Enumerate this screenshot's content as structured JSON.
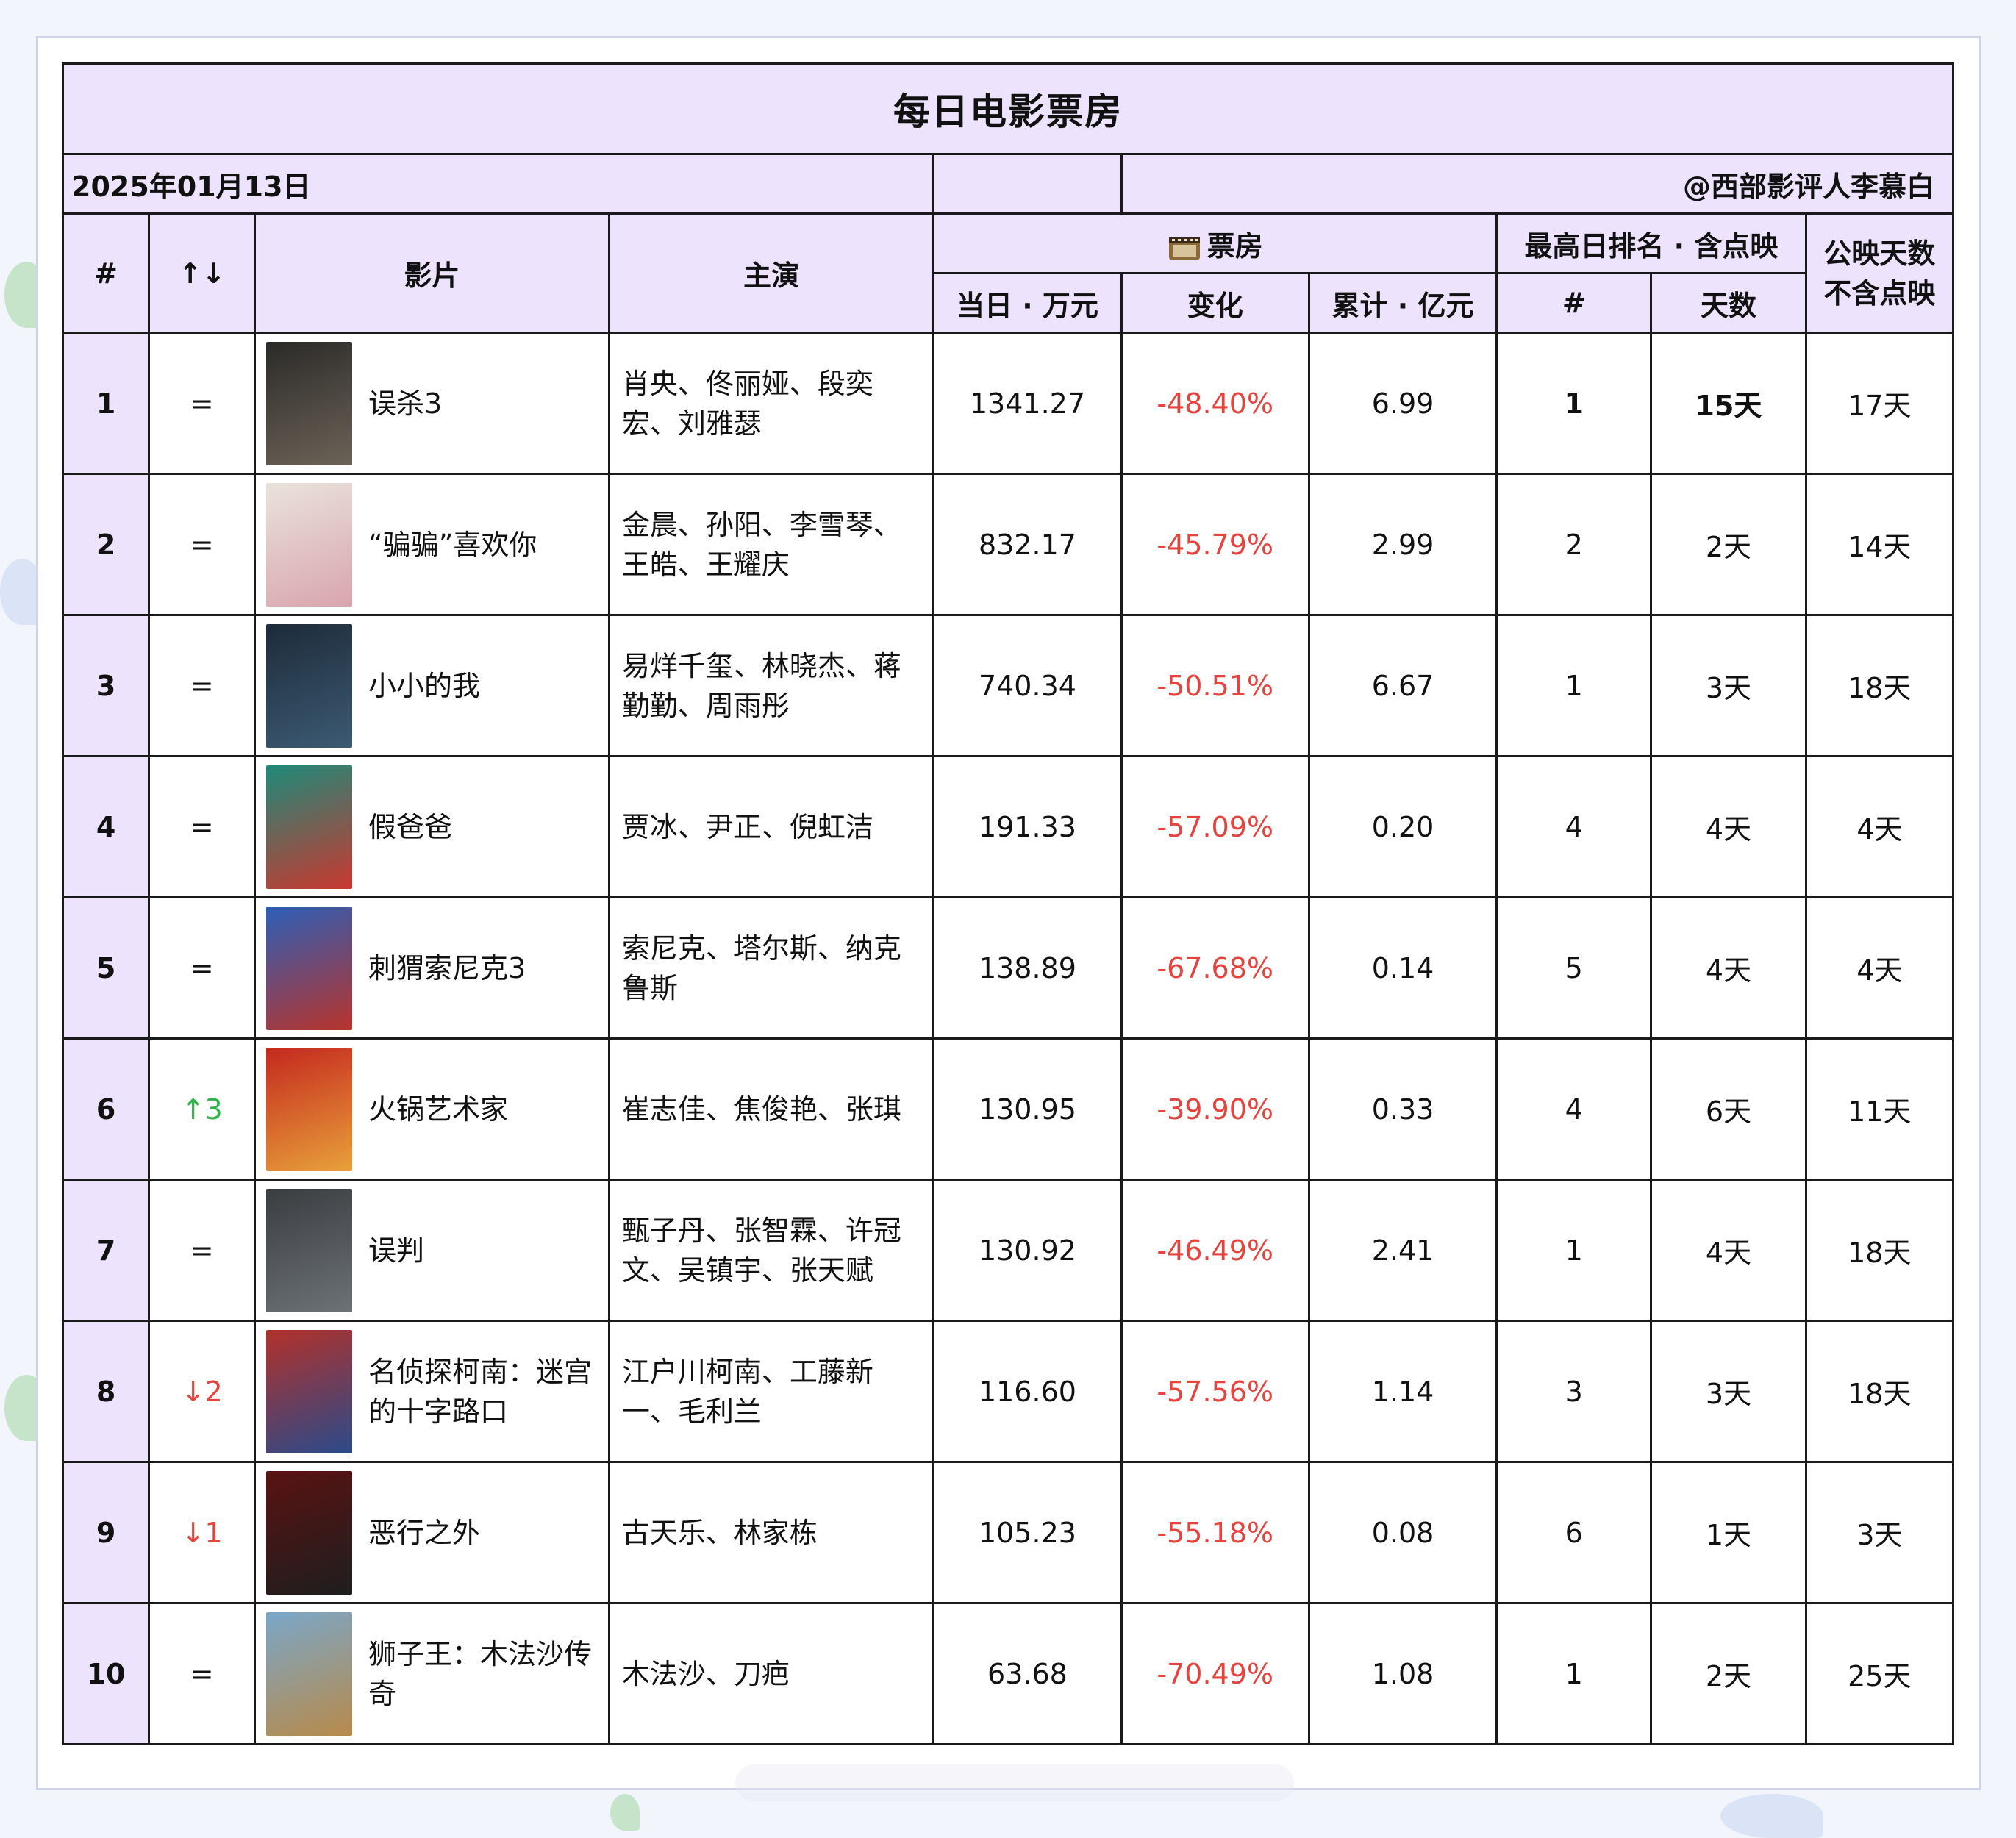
{
  "title": "每日电影票房",
  "date": "2025年01月13日",
  "author": "@西部影评人李慕白",
  "headers": {
    "rank": "#",
    "change": "↑↓",
    "film": "影片",
    "cast": "主演",
    "boxoffice_group": "票房",
    "today": "当日 · 万元",
    "delta": "变化",
    "total": "累计 · 亿元",
    "best_group": "最高日排名 · 含点映",
    "best_rank": "#",
    "best_days": "天数",
    "release_days": "公映天数\n不含点映"
  },
  "colors": {
    "header_bg": "#ede3fd",
    "negative": "#e5433d",
    "up": "#2cb34a",
    "down": "#e5433d"
  },
  "rows": [
    {
      "rank": "1",
      "change": "=",
      "change_type": "same",
      "film": "误杀3",
      "cast": "肖央、佟丽娅、段奕宏、刘雅瑟",
      "today": "1341.27",
      "delta": "-48.40%",
      "total": "6.99",
      "best_rank": "1",
      "best_days": "15天",
      "release_days": "17天",
      "poster_colors": [
        "#2b2a28",
        "#6b6357"
      ]
    },
    {
      "rank": "2",
      "change": "=",
      "change_type": "same",
      "film": "“骗骗”喜欢你",
      "cast": "金晨、孙阳、李雪琴、王皓、王耀庆",
      "today": "832.17",
      "delta": "-45.79%",
      "total": "2.99",
      "best_rank": "2",
      "best_days": "2天",
      "release_days": "14天",
      "poster_colors": [
        "#e9e3dc",
        "#d9a5ad"
      ]
    },
    {
      "rank": "3",
      "change": "=",
      "change_type": "same",
      "film": "小小的我",
      "cast": "易烊千玺、林晓杰、蒋勤勤、周雨彤",
      "today": "740.34",
      "delta": "-50.51%",
      "total": "6.67",
      "best_rank": "1",
      "best_days": "3天",
      "release_days": "18天",
      "poster_colors": [
        "#1d2b3a",
        "#3c5a73"
      ]
    },
    {
      "rank": "4",
      "change": "=",
      "change_type": "same",
      "film": "假爸爸",
      "cast": "贾冰、尹正、倪虹洁",
      "today": "191.33",
      "delta": "-57.09%",
      "total": "0.20",
      "best_rank": "4",
      "best_days": "4天",
      "release_days": "4天",
      "poster_colors": [
        "#1d8a7a",
        "#c9382f"
      ]
    },
    {
      "rank": "5",
      "change": "=",
      "change_type": "same",
      "film": "刺猬索尼克3",
      "cast": "索尼克、塔尔斯、纳克鲁斯",
      "today": "138.89",
      "delta": "-67.68%",
      "total": "0.14",
      "best_rank": "5",
      "best_days": "4天",
      "release_days": "4天",
      "poster_colors": [
        "#2c5fb8",
        "#b8342c"
      ]
    },
    {
      "rank": "6",
      "change": "↑3",
      "change_type": "up",
      "film": "火锅艺术家",
      "cast": "崔志佳、焦俊艳、张琪",
      "today": "130.95",
      "delta": "-39.90%",
      "total": "0.33",
      "best_rank": "4",
      "best_days": "6天",
      "release_days": "11天",
      "poster_colors": [
        "#c4281e",
        "#e8a13a"
      ]
    },
    {
      "rank": "7",
      "change": "=",
      "change_type": "same",
      "film": "误判",
      "cast": "甄子丹、张智霖、许冠文、吴镇宇、张天赋",
      "today": "130.92",
      "delta": "-46.49%",
      "total": "2.41",
      "best_rank": "1",
      "best_days": "4天",
      "release_days": "18天",
      "poster_colors": [
        "#3a3d40",
        "#6d7276"
      ]
    },
    {
      "rank": "8",
      "change": "↓2",
      "change_type": "down",
      "film": "名侦探柯南：迷宫的十字路口",
      "cast": "江户川柯南、工藤新一、毛利兰",
      "today": "116.60",
      "delta": "-57.56%",
      "total": "1.14",
      "best_rank": "3",
      "best_days": "3天",
      "release_days": "18天",
      "poster_colors": [
        "#b3312a",
        "#2a4a8a"
      ]
    },
    {
      "rank": "9",
      "change": "↓1",
      "change_type": "down",
      "film": "恶行之外",
      "cast": "古天乐、林家栋",
      "today": "105.23",
      "delta": "-55.18%",
      "total": "0.08",
      "best_rank": "6",
      "best_days": "1天",
      "release_days": "3天",
      "poster_colors": [
        "#5a1212",
        "#1e1e1e"
      ]
    },
    {
      "rank": "10",
      "change": "=",
      "change_type": "same",
      "film": "狮子王：木法沙传奇",
      "cast": "木法沙、刀疤",
      "today": "63.68",
      "delta": "-70.49%",
      "total": "1.08",
      "best_rank": "1",
      "best_days": "2天",
      "release_days": "25天",
      "poster_colors": [
        "#7aa7c9",
        "#b88a4a"
      ]
    }
  ]
}
